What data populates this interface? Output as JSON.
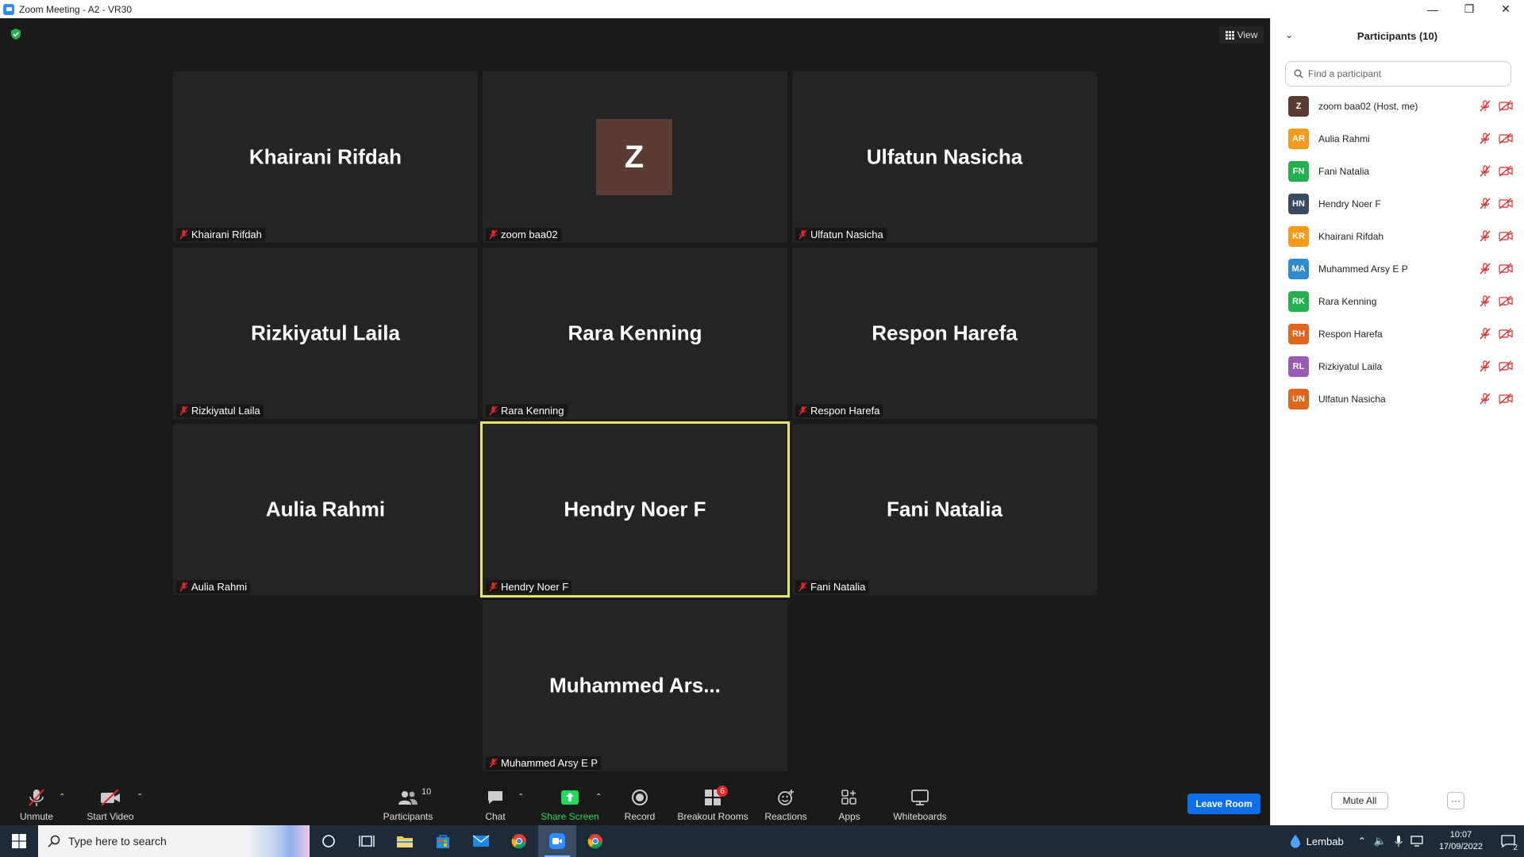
{
  "window": {
    "title": "Zoom Meeting - A2 - VR30"
  },
  "colors": {
    "accent": "#0e71eb",
    "active_speaker": "#e5e86a",
    "share_green": "#23d959",
    "mute_red": "#e02828"
  },
  "meeting": {
    "view_label": "View",
    "tiles": [
      {
        "display_name": "Khairani Rifdah",
        "label": "Khairani Rifdah"
      },
      {
        "display_name": "Z",
        "label": "zoom baa02"
      },
      {
        "display_name": "Ulfatun Nasicha",
        "label": "Ulfatun Nasicha"
      },
      {
        "display_name": "Rizkiyatul Laila",
        "label": "Rizkiyatul Laila"
      },
      {
        "display_name": "Rara Kenning",
        "label": "Rara Kenning"
      },
      {
        "display_name": "Respon Harefa",
        "label": "Respon Harefa"
      },
      {
        "display_name": "Aulia Rahmi",
        "label": "Aulia Rahmi"
      },
      {
        "display_name": "Hendry Noer F",
        "label": "Hendry Noer F"
      },
      {
        "display_name": "Fani Natalia",
        "label": "Fani Natalia"
      },
      {
        "display_name": "Muhammed  Ars...",
        "label": "Muhammed Arsy E P"
      }
    ]
  },
  "toolbar": {
    "unmute": "Unmute",
    "start_video": "Start Video",
    "participants": "Participants",
    "participants_count": "10",
    "chat": "Chat",
    "share_screen": "Share Screen",
    "record": "Record",
    "breakout_rooms": "Breakout Rooms",
    "breakout_badge": "6",
    "reactions": "Reactions",
    "apps": "Apps",
    "whiteboards": "Whiteboards",
    "leave_room": "Leave Room"
  },
  "panel": {
    "title": "Participants (10)",
    "search_placeholder": "Find a participant",
    "participants": [
      {
        "initials": "Z",
        "name": "zoom baa02 (Host, me)",
        "color": "#5b3b32"
      },
      {
        "initials": "AR",
        "name": "Aulia Rahmi",
        "color": "#f59a1b"
      },
      {
        "initials": "FN",
        "name": "Fani Natalia",
        "color": "#23b14d"
      },
      {
        "initials": "HN",
        "name": "Hendry Noer F",
        "color": "#3a4a63"
      },
      {
        "initials": "KR",
        "name": "Khairani Rifdah",
        "color": "#f59a1b"
      },
      {
        "initials": "MA",
        "name": "Muhammed Arsy E P",
        "color": "#2d8ccf"
      },
      {
        "initials": "RK",
        "name": "Rara Kenning",
        "color": "#23b14d"
      },
      {
        "initials": "RH",
        "name": "Respon Harefa",
        "color": "#e1651b"
      },
      {
        "initials": "RL",
        "name": "Rizkiyatul Laila",
        "color": "#9b59b6"
      },
      {
        "initials": "UN",
        "name": "Ulfatun Nasicha",
        "color": "#e1651b"
      }
    ],
    "mute_all": "Mute All",
    "more": "···"
  },
  "taskbar": {
    "search_placeholder": "Type here to search",
    "weather": "Lembab",
    "time": "10:07",
    "date": "17/09/2022",
    "notifications": "2"
  }
}
